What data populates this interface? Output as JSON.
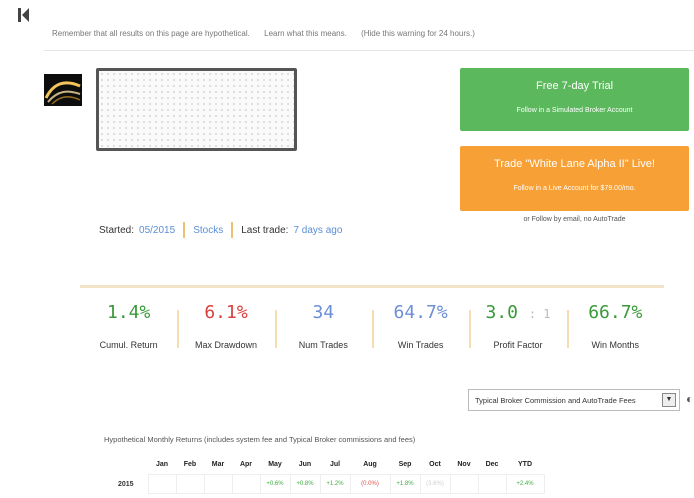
{
  "warning": {
    "text": "Remember that all results on this page are hypothetical.",
    "learn_link": "Learn what this means.",
    "hide_link": "(Hide this warning for 24 hours.)"
  },
  "cta": {
    "trial_title": "Free 7-day Trial",
    "trial_sub": "Follow in a Simulated Broker Account",
    "live_title": "Trade \"White Lane Alpha II\" Live!",
    "live_sub": "Follow in a Live Account for $79.00/mo.",
    "email_link": "or Follow by email, no AutoTrade"
  },
  "meta": {
    "started_label": "Started:",
    "started_value": "05/2015",
    "category": "Stocks",
    "last_trade_label": "Last trade:",
    "last_trade_value": "7 days ago"
  },
  "stats": [
    {
      "value": "1.4%",
      "label": "Cumul. Return",
      "color": "#3a9a3a"
    },
    {
      "value": "6.1%",
      "label": "Max Drawdown",
      "color": "#d9413e"
    },
    {
      "value": "34",
      "label": "Num Trades",
      "color": "#6d8fd6"
    },
    {
      "value": "64.7%",
      "label": "Win Trades",
      "color": "#6d8fd6"
    },
    {
      "value": "3.0",
      "value_suffix": ": 1",
      "label": "Profit Factor",
      "color": "#3a9a3a"
    },
    {
      "value": "66.7%",
      "label": "Win Months",
      "color": "#3a9a3a"
    }
  ],
  "fee_select": {
    "selected": "Typical Broker Commission and AutoTrade Fees"
  },
  "monthly": {
    "title": "Hypothetical Monthly Returns (includes system fee and Typical Broker commissions and fees)",
    "columns": [
      "",
      "Jan",
      "Feb",
      "Mar",
      "Apr",
      "May",
      "Jun",
      "Jul",
      "Aug",
      "Sep",
      "Oct",
      "Nov",
      "Dec",
      "YTD"
    ],
    "rows": [
      {
        "year": "2015",
        "cells": [
          "",
          "",
          "",
          "",
          "+0.6%",
          "+0.8%",
          "+1.2%",
          "(0.0%)",
          "+1.8%",
          "(3.6%)",
          "",
          "",
          "+2.4%"
        ],
        "styles": [
          "",
          "",
          "",
          "",
          "pos",
          "pos",
          "pos",
          "neg",
          "pos",
          "muted",
          "",
          "",
          "pos"
        ]
      }
    ]
  },
  "colors": {
    "green_button": "#5cb85c",
    "orange_button": "#f7a035",
    "link_blue": "#5b8fd6"
  },
  "icons": [
    "back-bar-icon",
    "avatar-image",
    "dropdown-arrow-icon"
  ]
}
